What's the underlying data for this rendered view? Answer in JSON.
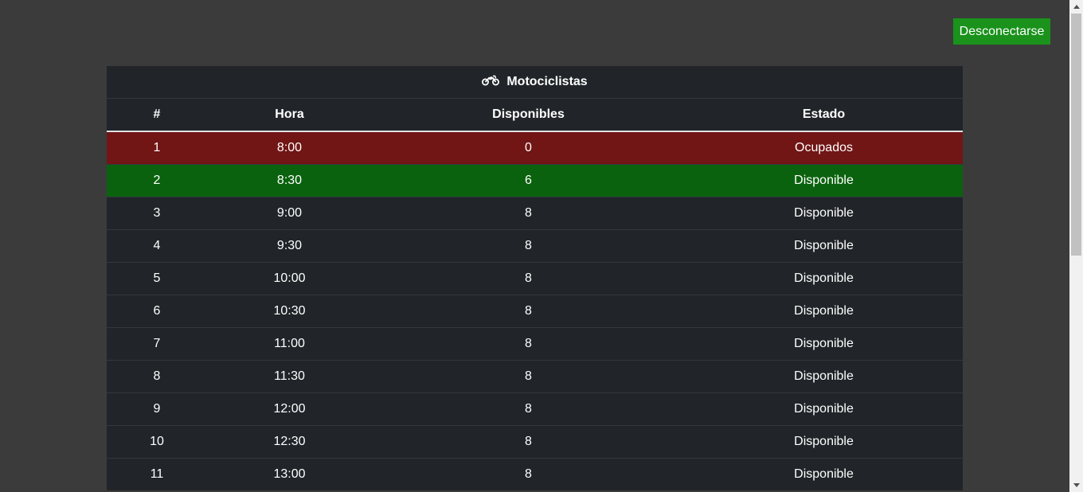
{
  "header": {
    "logout_label": "Desconectarse"
  },
  "table": {
    "caption": "Motociclistas",
    "caption_icon": "motorcycle-icon",
    "columns": [
      "#",
      "Hora",
      "Disponibles",
      "Estado"
    ],
    "rows": [
      {
        "num": "1",
        "hora": "8:00",
        "disponibles": "0",
        "estado": "Ocupados",
        "status": "danger"
      },
      {
        "num": "2",
        "hora": "8:30",
        "disponibles": "6",
        "estado": "Disponible",
        "status": "success"
      },
      {
        "num": "3",
        "hora": "9:00",
        "disponibles": "8",
        "estado": "Disponible",
        "status": "default"
      },
      {
        "num": "4",
        "hora": "9:30",
        "disponibles": "8",
        "estado": "Disponible",
        "status": "default"
      },
      {
        "num": "5",
        "hora": "10:00",
        "disponibles": "8",
        "estado": "Disponible",
        "status": "default"
      },
      {
        "num": "6",
        "hora": "10:30",
        "disponibles": "8",
        "estado": "Disponible",
        "status": "default"
      },
      {
        "num": "7",
        "hora": "11:00",
        "disponibles": "8",
        "estado": "Disponible",
        "status": "default"
      },
      {
        "num": "8",
        "hora": "11:30",
        "disponibles": "8",
        "estado": "Disponible",
        "status": "default"
      },
      {
        "num": "9",
        "hora": "12:00",
        "disponibles": "8",
        "estado": "Disponible",
        "status": "default"
      },
      {
        "num": "10",
        "hora": "12:30",
        "disponibles": "8",
        "estado": "Disponible",
        "status": "default"
      },
      {
        "num": "11",
        "hora": "13:00",
        "disponibles": "8",
        "estado": "Disponible",
        "status": "default"
      }
    ]
  },
  "colors": {
    "page_bg": "#3b3b3b",
    "table_bg": "#212529",
    "logout_bg": "#1a921c",
    "danger_row": "#711515",
    "success_row": "#0b620e"
  }
}
